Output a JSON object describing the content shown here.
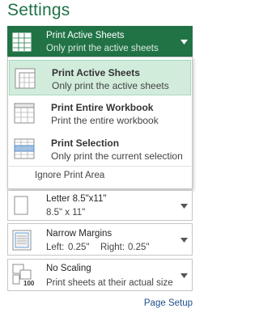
{
  "title": "Settings",
  "active": {
    "label": "Print Active Sheets",
    "sub": "Only print the active sheets"
  },
  "options": [
    {
      "label": "Print Active Sheets",
      "sub": "Only print the active sheets",
      "selected": true
    },
    {
      "label": "Print Entire Workbook",
      "sub": "Print the entire workbook",
      "selected": false
    },
    {
      "label": "Print Selection",
      "sub": "Only print the current selection",
      "selected": false
    }
  ],
  "ignore_label": "Ignore Print Area",
  "paper": {
    "label": "Letter 8.5\"x11\"",
    "sub": "8.5\" x 11\""
  },
  "margins": {
    "label": "Narrow Margins",
    "left_label": "Left:",
    "left_value": "0.25\"",
    "right_label": "Right:",
    "right_value": "0.25\""
  },
  "scaling": {
    "label": "No Scaling",
    "sub": "Print sheets at their actual size",
    "badge": "100"
  },
  "page_setup": "Page Setup",
  "colors": {
    "accent": "#217346",
    "selected_bg": "#d2ecdc",
    "link": "#1e4e8c"
  },
  "icons": [
    "sheet-grid-icon",
    "workbook-icon",
    "selection-icon",
    "paper-size-icon",
    "margins-icon",
    "scaling-icon",
    "chevron-down-icon"
  ]
}
